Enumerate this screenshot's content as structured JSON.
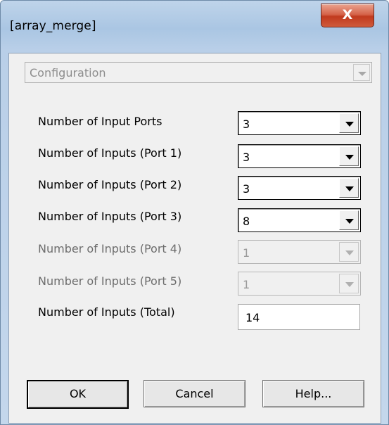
{
  "window": {
    "title": "[array_merge]",
    "close_label": "X"
  },
  "config": {
    "value": "Configuration"
  },
  "rows": [
    {
      "label": "Number of Input Ports",
      "value": "3",
      "enabled": true
    },
    {
      "label": "Number of Inputs (Port 1)",
      "value": "3",
      "enabled": true
    },
    {
      "label": "Number of Inputs (Port 2)",
      "value": "3",
      "enabled": true
    },
    {
      "label": "Number of Inputs (Port 3)",
      "value": "8",
      "enabled": true
    },
    {
      "label": "Number of Inputs (Port 4)",
      "value": "1",
      "enabled": false
    },
    {
      "label": "Number of Inputs (Port 5)",
      "value": "1",
      "enabled": false
    }
  ],
  "total": {
    "label": "Number of Inputs (Total)",
    "value": "14"
  },
  "buttons": {
    "ok": "OK",
    "cancel": "Cancel",
    "help": "Help..."
  }
}
